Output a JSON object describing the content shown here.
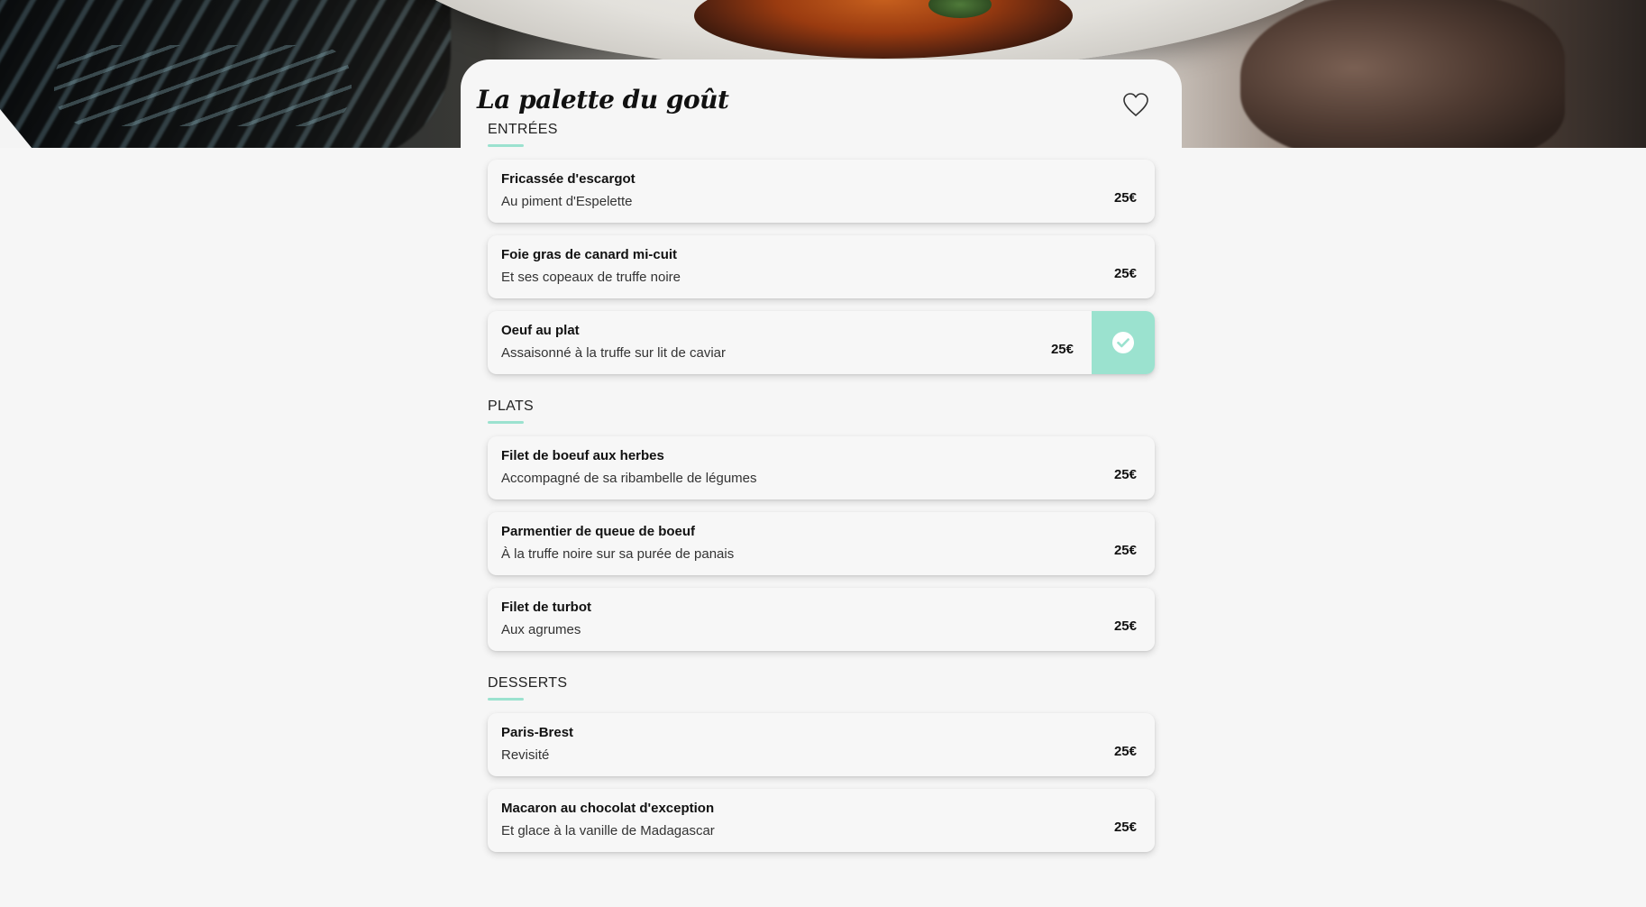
{
  "restaurant": {
    "name": "La palette du goût"
  },
  "colors": {
    "accent": "#9be2cf",
    "background": "#f6f6f6",
    "text": "#111111"
  },
  "icons": {
    "favorite": "heart-outline-icon",
    "selected": "check-circle-icon"
  },
  "sections": [
    {
      "title": "ENTRÉES",
      "dishes": [
        {
          "name": "Fricassée d'escargot",
          "description": "Au piment d'Espelette",
          "price": "25€",
          "selected": false
        },
        {
          "name": "Foie gras de canard mi-cuit",
          "description": "Et ses copeaux de truffe noire",
          "price": "25€",
          "selected": false
        },
        {
          "name": "Oeuf au plat",
          "description": "Assaisonné à la truffe sur lit de caviar",
          "price": "25€",
          "selected": true
        }
      ]
    },
    {
      "title": "PLATS",
      "dishes": [
        {
          "name": "Filet de boeuf aux herbes",
          "description": "Accompagné de sa ribambelle de légumes",
          "price": "25€",
          "selected": false
        },
        {
          "name": "Parmentier de queue de boeuf",
          "description": "À la truffe noire sur sa purée de panais",
          "price": "25€",
          "selected": false
        },
        {
          "name": "Filet de turbot",
          "description": "Aux agrumes",
          "price": "25€",
          "selected": false
        }
      ]
    },
    {
      "title": "DESSERTS",
      "dishes": [
        {
          "name": "Paris-Brest",
          "description": "Revisité",
          "price": "25€",
          "selected": false
        },
        {
          "name": "Macaron au chocolat d'exception",
          "description": "Et glace à la vanille de Madagascar",
          "price": "25€",
          "selected": false
        }
      ]
    }
  ]
}
